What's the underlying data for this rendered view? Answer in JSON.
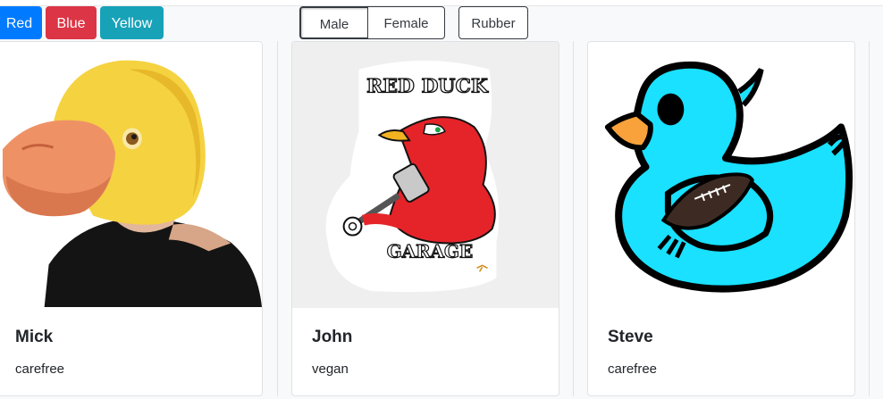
{
  "color_filters": {
    "red_label": "Red",
    "blue_label": "Blue",
    "yellow_label": "Yellow"
  },
  "gender_filters": {
    "male_label": "Male",
    "female_label": "Female",
    "selected": "Male"
  },
  "type_filters": {
    "rubber_label": "Rubber"
  },
  "colors": {
    "primary": "#007bff",
    "danger": "#dc3545",
    "info": "#17a2b8",
    "dark": "#343a40"
  },
  "cards": [
    {
      "name": "Mick",
      "trait": "carefree",
      "image_icon": "duck-mask-person-image"
    },
    {
      "name": "John",
      "trait": "vegan",
      "image_icon": "red-duck-garage-sticker-image",
      "sticker": {
        "top_text": "RED DUCK",
        "bottom_text": "GARAGE"
      }
    },
    {
      "name": "Steve",
      "trait": "carefree",
      "image_icon": "blue-rubber-duck-football-image"
    }
  ]
}
